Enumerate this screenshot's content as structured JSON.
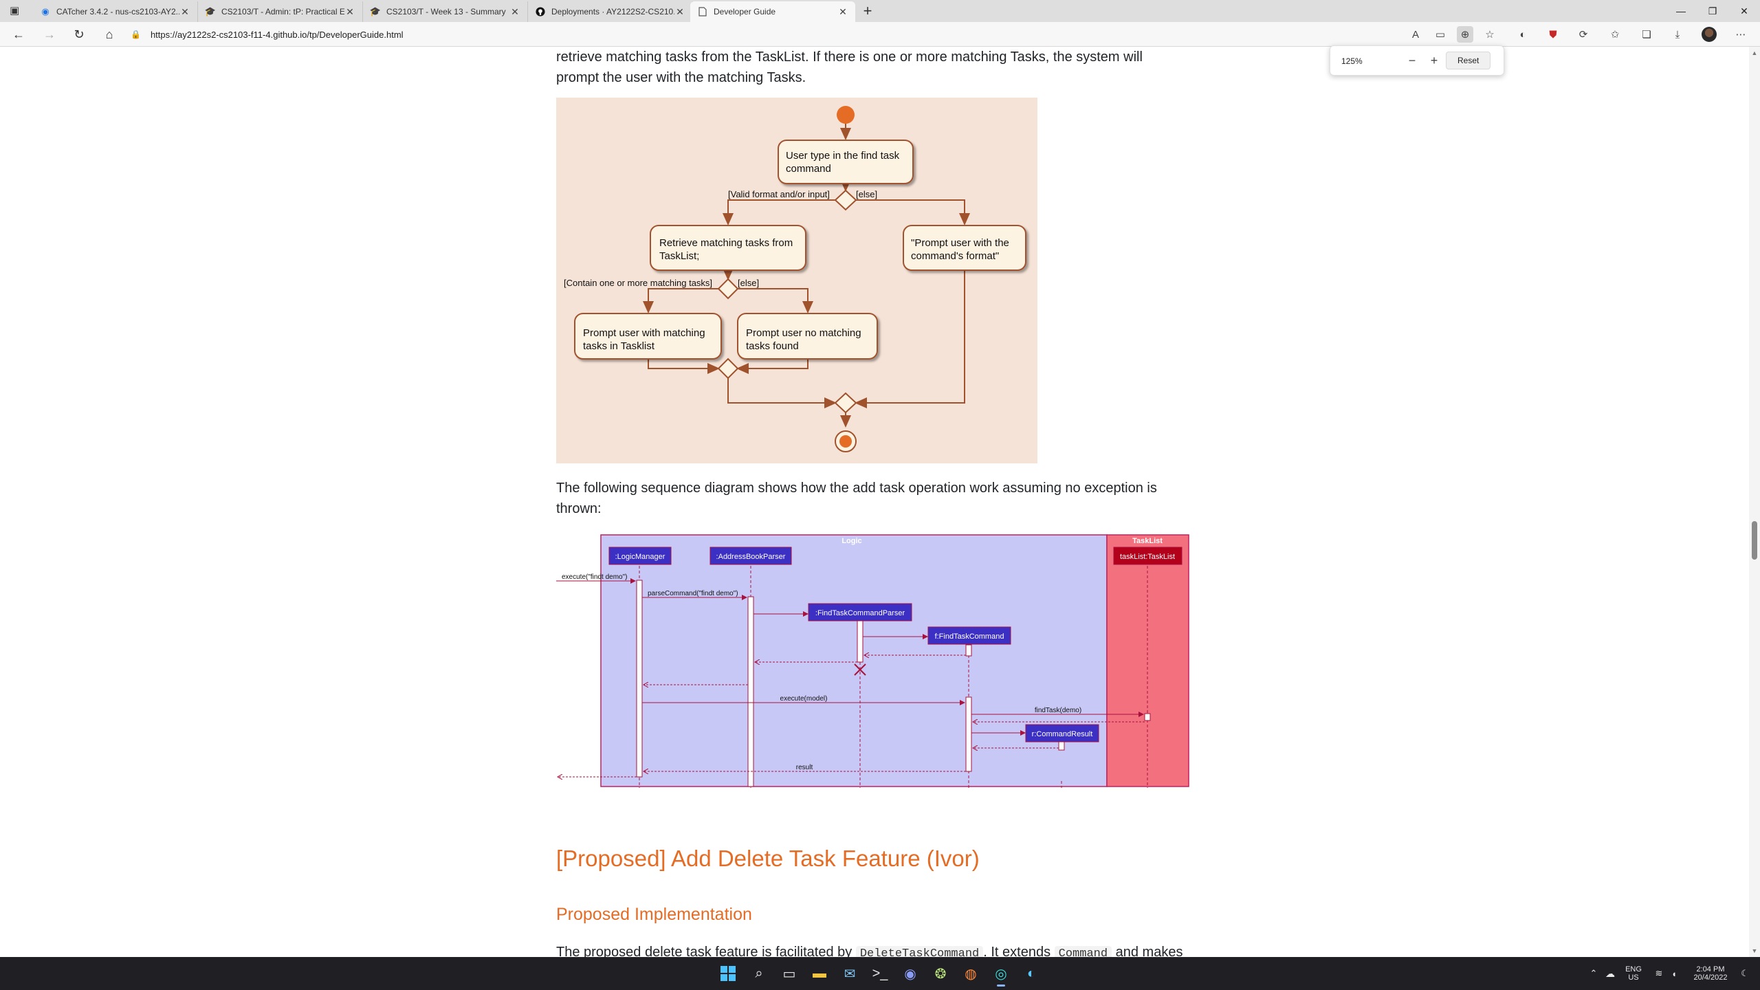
{
  "browser": {
    "tabs": [
      {
        "title": "CATcher 3.4.2 - nus-cs2103-AY2...",
        "icon": "catcher-icon",
        "active": false
      },
      {
        "title": "CS2103/T - Admin: tP: Practical E...",
        "icon": "graduation-cap-icon",
        "active": false
      },
      {
        "title": "CS2103/T - Week 13 - Summary",
        "icon": "graduation-cap-icon",
        "active": false
      },
      {
        "title": "Deployments · AY2122S2-CS210...",
        "icon": "github-icon",
        "active": false
      },
      {
        "title": "Developer Guide",
        "icon": "page-icon",
        "active": true
      }
    ],
    "url": "https://ay2122s2-cs2103-f11-4.github.io/tp/DeveloperGuide.html",
    "zoom_popup": {
      "value": "125%",
      "reset_label": "Reset"
    }
  },
  "page": {
    "intro_text": "retrieve matching tasks from the TaskList. If there is one or more matching Tasks, the system will prompt the user with the matching Tasks.",
    "activity_diagram": {
      "nodes": {
        "step1": [
          "User type in the find task",
          "command"
        ],
        "retrieve": [
          "Retrieve matching tasks from",
          "TaskList;"
        ],
        "prompt_format": [
          "\"Prompt user with the",
          "command's format\""
        ],
        "prompt_matching": [
          "Prompt user with matching",
          "tasks in Tasklist"
        ],
        "prompt_none": [
          "Prompt user no matching",
          "tasks found"
        ]
      },
      "guards": {
        "valid": "[Valid format and/or input]",
        "else1": "[else]",
        "contain": "[Contain one or more matching tasks]",
        "else2": "[else]"
      }
    },
    "sequence_text": "The following sequence diagram shows how the add task operation work assuming no exception is thrown:",
    "sequence_diagram": {
      "box_logic": "Logic",
      "box_tasklist": "TaskList",
      "participants": {
        "logic_manager": ":LogicManager",
        "parser": ":AddressBookParser",
        "find_parser": ":FindTaskCommandParser",
        "find_command": "f:FindTaskCommand",
        "tasklist": "taskList:TaskList",
        "command_result": "r:CommandResult"
      },
      "messages": {
        "m1": "execute(\"findt demo\")",
        "m2": "parseCommand(\"findt demo\")",
        "m3": "execute(model)",
        "m4": "findTask(demo)",
        "m5": "result"
      }
    },
    "heading_proposed": "[Proposed] Add Delete Task Feature (Ivor)",
    "subheading_impl": "Proposed Implementation",
    "bottom_text": {
      "before": "The proposed delete task feature is facilitated by ",
      "code1": "DeleteTaskCommand",
      "middle": ". It extends ",
      "code2": "Command",
      "after": " and makes"
    }
  },
  "taskbar": {
    "lang_top": "ENG",
    "lang_bottom": "US",
    "time": "2:04 PM",
    "date": "20/4/2022"
  }
}
